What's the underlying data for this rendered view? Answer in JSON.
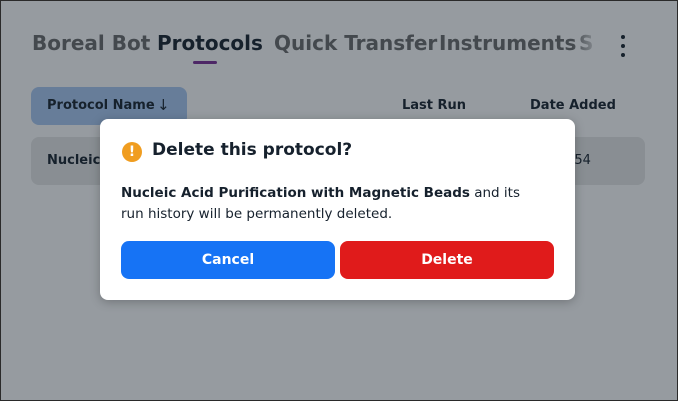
{
  "nav": {
    "tabs": [
      {
        "label": "Boreal Bot"
      },
      {
        "label": "Protocols"
      },
      {
        "label": "Quick Transfer"
      },
      {
        "label": "Instruments"
      },
      {
        "label": "S"
      }
    ],
    "active_tab": "Protocols"
  },
  "table": {
    "columns": {
      "name": "Protocol Name",
      "last_run": "Last Run",
      "date_added": "Date Added"
    },
    "sort_icon": "arrow-down-icon",
    "rows": [
      {
        "name": "Nucleic",
        "date_added": "4 15:54"
      }
    ]
  },
  "dialog": {
    "icon": "warning-icon",
    "title": "Delete this protocol?",
    "body_bold": "Nucleic Acid Purification with Magnetic Beads",
    "body_rest": " and its run history will be permanently deleted.",
    "cancel_label": "Cancel",
    "delete_label": "Delete"
  },
  "colors": {
    "accent": "#7a2d96",
    "cancel_button": "#1673f5",
    "delete_button": "#e01b1b",
    "warning_icon": "#f09d20",
    "sort_pill": "#a9c9f3"
  }
}
